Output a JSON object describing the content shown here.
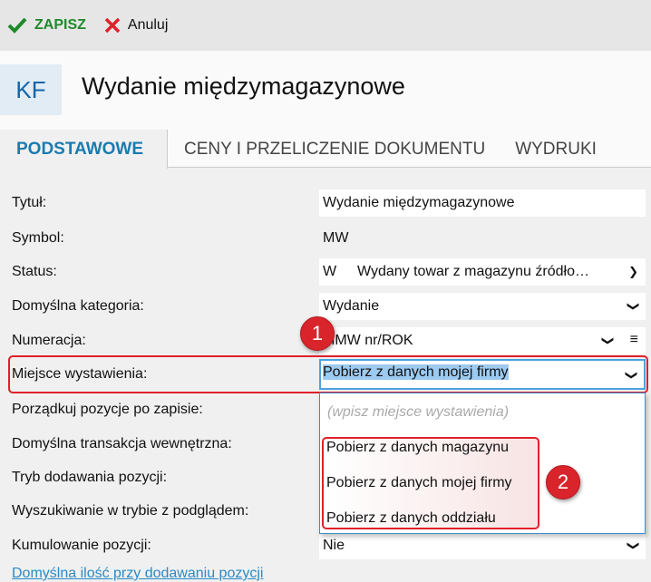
{
  "toolbar": {
    "save": "ZAPISZ",
    "cancel": "Anuluj"
  },
  "header": {
    "initials": "KF",
    "title": "Wydanie międzymagazynowe"
  },
  "tabs": [
    "PODSTAWOWE",
    "CENY I PRZELICZENIE DOKUMENTU",
    "WYDRUKI"
  ],
  "labels": {
    "tytul": "Tytuł:",
    "symbol": "Symbol:",
    "status": "Status:",
    "kategoria": "Domyślna kategoria:",
    "numeracja": "Numeracja:",
    "miejsce": "Miejsce wystawienia:",
    "porzadkuj": "Porządkuj pozycje po zapisie:",
    "transakcja": "Domyślna transakcja wewnętrzna:",
    "tryb": "Tryb dodawania pozycji:",
    "wyszukiwanie": "Wyszukiwanie w trybie z podglądem:",
    "kumulowanie": "Kumulowanie pozycji:"
  },
  "values": {
    "tytul": "Wydanie międzymagazynowe",
    "symbol": "MW",
    "status_code": "W",
    "status": "Wydany towar z magazynu źródło…",
    "kategoria": "Wydanie",
    "numeracja": "MMW nr/ROK",
    "miejsce": "Pobierz z danych mojej firmy",
    "kumulowanie": "Nie"
  },
  "dropdown": {
    "placeholder": "(wpisz miejsce wystawienia)",
    "options": [
      "Pobierz z danych magazynu",
      "Pobierz z danych mojej firmy",
      "Pobierz z danych oddziału"
    ]
  },
  "badges": [
    "1",
    "2"
  ],
  "link": "Domyślna ilość przy dodawaniu pozycji"
}
